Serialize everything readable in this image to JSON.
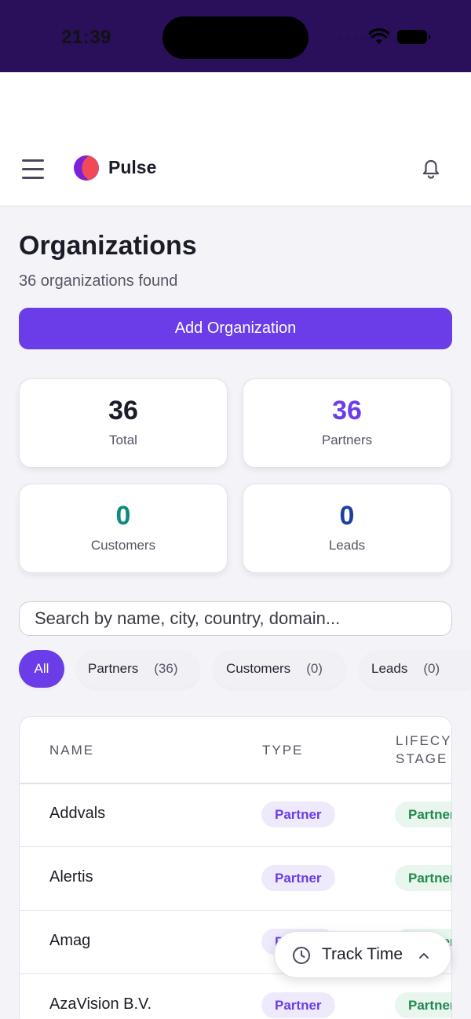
{
  "status_bar": {
    "time": "21:39"
  },
  "app": {
    "brand": "Pulse"
  },
  "page": {
    "title": "Organizations",
    "subtitle": "36 organizations found",
    "add_button": "Add Organization"
  },
  "stats": [
    {
      "value": "36",
      "label": "Total",
      "color": "#1c1c28"
    },
    {
      "value": "36",
      "label": "Partners",
      "color": "#6a3de8"
    },
    {
      "value": "0",
      "label": "Customers",
      "color": "#0f8a7c"
    },
    {
      "value": "0",
      "label": "Leads",
      "color": "#1e3fa0"
    }
  ],
  "search": {
    "placeholder": "Search by name, city, country, domain..."
  },
  "filters": [
    {
      "label": "All",
      "active": true
    },
    {
      "label": "Partners",
      "count": "(36)"
    },
    {
      "label": "Customers",
      "count": "(0)"
    },
    {
      "label": "Leads",
      "count": "(0)"
    }
  ],
  "table": {
    "columns": [
      "NAME",
      "TYPE",
      "LIFECYCLE",
      "STAGE"
    ],
    "rows": [
      {
        "name": "Addvals",
        "type": "Partner",
        "stage": "Partner"
      },
      {
        "name": "Alertis",
        "type": "Partner",
        "stage": "Partner"
      },
      {
        "name": "Amag",
        "type": "Partner",
        "stage": "Partner"
      },
      {
        "name": "AzaVision B.V.",
        "type": "Partner",
        "stage": "Partner"
      }
    ]
  },
  "track_time": {
    "label": "Track Time"
  },
  "icons": [
    "menu-icon",
    "pulse-logo",
    "bell-icon",
    "clock-icon",
    "chevron-up-icon",
    "wifi-icon",
    "battery-icon"
  ]
}
